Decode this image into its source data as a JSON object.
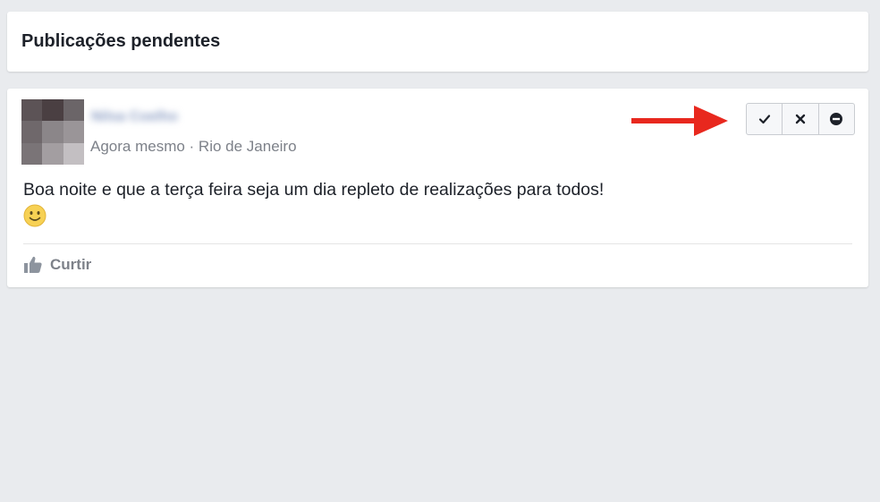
{
  "header": {
    "title": "Publicações pendentes"
  },
  "post": {
    "author_name": "Nilsa Coelho",
    "meta": "Agora mesmo · Rio de Janeiro",
    "text": "Boa noite e que a terça feira seja um dia repleto de realizações para todos!",
    "emoji": "slightly-smiling-face",
    "actions": [
      {
        "icon": "check-icon"
      },
      {
        "icon": "close-icon"
      },
      {
        "icon": "minus-circle-icon"
      }
    ],
    "like_label": "Curtir"
  },
  "colors": {
    "background": "#e9ebee",
    "card": "#ffffff",
    "arrow": "#e8281e",
    "meta_text": "#7d8189",
    "action_border": "#c9ccd1",
    "action_background": "#f6f7f9"
  },
  "avatar_pixels": [
    "#5c5356",
    "#4a3f42",
    "#6b6568",
    "#6f686b",
    "#8b8689",
    "#9a9598",
    "#7a7477",
    "#a39ea1",
    "#c3bfc2"
  ]
}
